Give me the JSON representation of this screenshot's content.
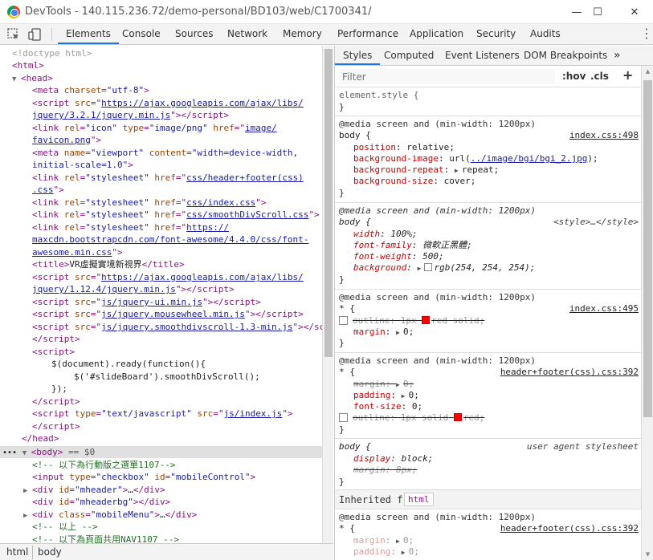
{
  "window": {
    "title": "DevTools - 140.115.236.72/demo-personal/BD103/web/C1700341/",
    "minimize": "—",
    "maximize": "☐",
    "close": "✕"
  },
  "toolbar": {
    "tabs": [
      "Elements",
      "Console",
      "Sources",
      "Network",
      "Memory",
      "Performance",
      "Application",
      "Security",
      "Audits"
    ],
    "active_tab": "Elements",
    "more": "⋮"
  },
  "dom": {
    "doctype": "<!doctype html>",
    "html_open": "<html>",
    "head_open": "<head>",
    "meta_charset": {
      "tag": "meta",
      "attr": "charset",
      "value": "\"utf-8\""
    },
    "script1": {
      "tag": "script",
      "attr": "src",
      "url1": "https://ajax.googleapis.com/ajax/libs/",
      "url2": "jquery/3.2.1/jquery.min.js"
    },
    "link_icon": {
      "attr1": "rel",
      "val1": "\"icon\"",
      "attr2": "type",
      "val2": "\"image/png\"",
      "attr3": "href",
      "url1": "image/",
      "url2": "favicon.png"
    },
    "meta_viewport": {
      "attr1": "name",
      "val1": "\"viewport\"",
      "attr2": "content",
      "val2a": "\"width=device-width,",
      "val2b": "initial-scale=1.0\""
    },
    "link_hf": {
      "url1": "css/header+footer(css)",
      "url2": ".css"
    },
    "link_index": "css/index.css",
    "link_smooth": "css/smoothDivScroll.css",
    "link_fa": {
      "url1": "https://",
      "url2": "maxcdn.bootstrapcdn.com/font-awesome/4.4.0/css/font-",
      "url3": "awesome.min.css"
    },
    "title_text": "VR虛擬實境新視界",
    "script2": {
      "url1": "https://ajax.googleapis.com/ajax/libs/",
      "url2": "jquery/1.12.4/jquery.min.js"
    },
    "script_ui": "js/jquery-ui.min.js",
    "script_wheel": "js/jquery.mousewheel.min.js",
    "script_smooth": "js/jquery.smoothdivscroll-1.3-min.js",
    "inline_js1": "$(document).ready(function(){",
    "inline_js2": "$('#slideBoard').smoothDivScroll();",
    "inline_js3": "});",
    "script_type": {
      "attr1": "type",
      "val1": "\"text/javascript\"",
      "attr2": "src",
      "url": "js/index.js"
    },
    "head_close": "</head>",
    "body_open": "<body>",
    "body_marker": "== $0",
    "comment1": "<!-- 以下為行動版之選單1107-->",
    "input": {
      "attr1": "type",
      "val1": "\"checkbox\"",
      "attr2": "id",
      "val2": "\"mobileControl\""
    },
    "div_mheader": "\"mheader\"",
    "div_mheaderbg": "\"mheaderbg\"",
    "div_mobilemenu": "\"mobileMenu\"",
    "comment2": "<!-- 以上 -->",
    "comment3": "<!-- 以下為頁面共用NAV1107 -->"
  },
  "breadcrumb": [
    "html",
    "body"
  ],
  "styles": {
    "tabs": [
      "Styles",
      "Computed",
      "Event Listeners",
      "DOM Breakpoints"
    ],
    "more": "»",
    "filter_placeholder": "Filter",
    "hov": ":hov",
    "cls": ".cls",
    "plus": "+",
    "element_style": "element.style {",
    "close_brace": "}",
    "media": "@media screen and (min-width: 1200px)",
    "rule1": {
      "selector": "body {",
      "source": "index.css:498",
      "decls": [
        [
          "position",
          "relative;"
        ],
        [
          "background-image",
          "url("
        ],
        [
          "background-repeat",
          "repeat;"
        ],
        [
          "background-size",
          "cover;"
        ]
      ],
      "bg_url": "../image/bgi/bgi_2.jpg",
      "bg_url_end": ");"
    },
    "rule2": {
      "selector": "body {",
      "source": "<style>…</style>",
      "decls": [
        [
          "width",
          "100%;"
        ],
        [
          "font-family",
          "微軟正黑體;"
        ],
        [
          "font-weight",
          "500;"
        ],
        [
          "background",
          "rgb(254, 254, 254);"
        ]
      ]
    },
    "rule3": {
      "selector": "* {",
      "source": "index.css:495",
      "outline_prop": "outline",
      "outline_val_a": "1px",
      "outline_val_b": "red solid;",
      "margin_prop": "margin",
      "margin_val": "0;"
    },
    "rule4": {
      "selector": "* {",
      "source": "header+footer(css).css:392",
      "decls": [
        [
          "margin",
          "0;"
        ],
        [
          "padding",
          "0;"
        ],
        [
          "font-size",
          "0;"
        ]
      ],
      "outline_prop": "outline",
      "outline_val_a": "1px solid",
      "outline_val_b": "red;"
    },
    "rule5": {
      "selector": "body {",
      "source": "user agent stylesheet",
      "decls": [
        [
          "display",
          "block;"
        ],
        [
          "margin",
          "8px;"
        ]
      ]
    },
    "inherited_label": "Inherited from",
    "inherited_tag": "html",
    "rule6": {
      "selector": "* {",
      "source": "header+footer(css).css:392",
      "decls": [
        [
          "margin",
          "0;"
        ],
        [
          "padding",
          "0;"
        ]
      ]
    }
  },
  "colors": {
    "accent": "#1a73e8",
    "red_swatch": "#ff0000",
    "body_bg_swatch": "#fefefe"
  }
}
